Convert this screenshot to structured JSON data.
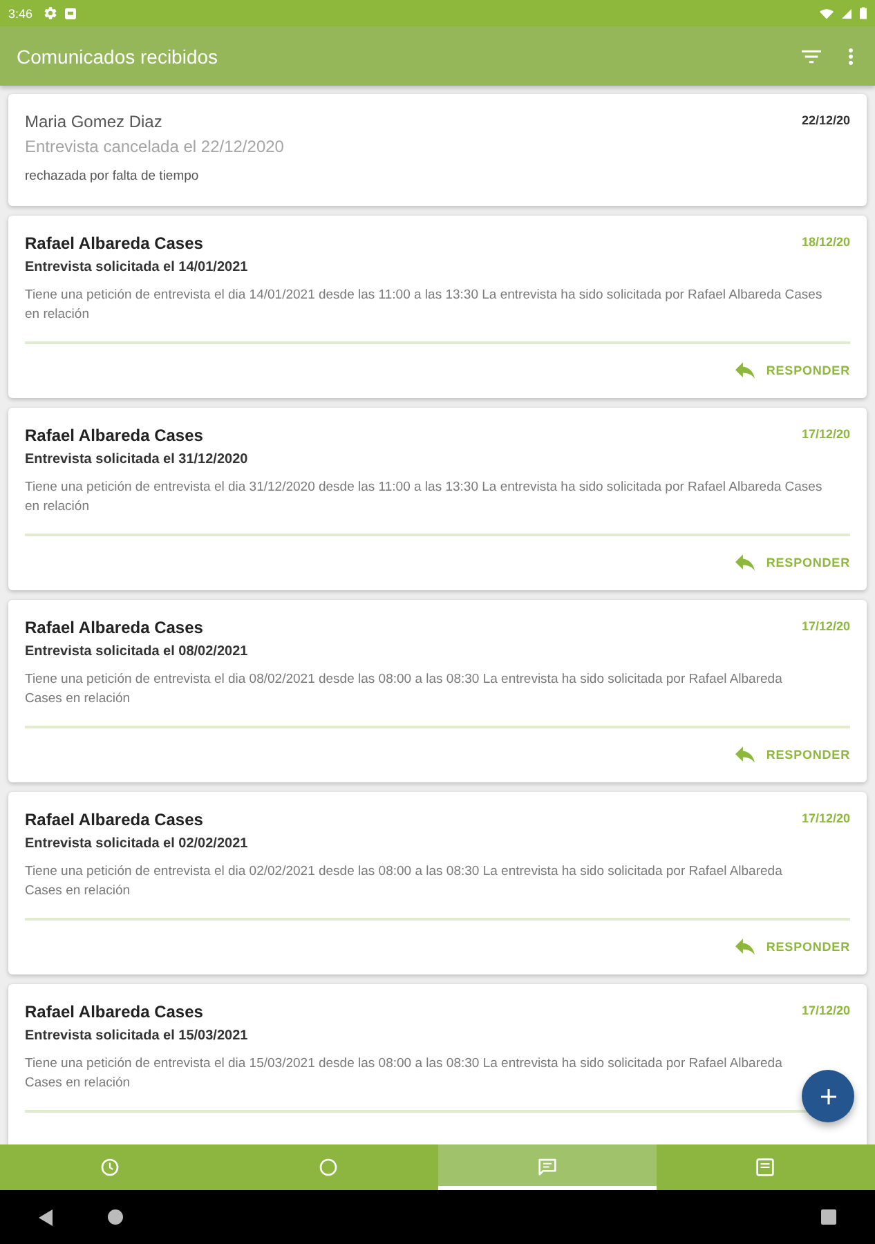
{
  "status_bar": {
    "time": "3:46"
  },
  "app_bar": {
    "title": "Comunicados recibidos"
  },
  "messages": [
    {
      "kind": "cancelled",
      "sender": "Maria Gomez Diaz",
      "date": "22/12/20",
      "subject": "Entrevista cancelada el 22/12/2020",
      "body": "rechazada por falta de tiempo"
    },
    {
      "kind": "request",
      "sender": "Rafael Albareda Cases",
      "date": "18/12/20",
      "subject": "Entrevista solicitada el 14/01/2021",
      "body": "Tiene una petición de entrevista el dia 14/01/2021 desde las 11:00 a las 13:30 La entrevista ha sido solicitada por Rafael Albareda Cases en relación",
      "action": "RESPONDER"
    },
    {
      "kind": "request",
      "sender": "Rafael Albareda Cases",
      "date": "17/12/20",
      "subject": "Entrevista solicitada el 31/12/2020",
      "body": "Tiene una petición de entrevista el dia 31/12/2020 desde las 11:00 a las 13:30 La entrevista ha sido solicitada por Rafael Albareda Cases en relación",
      "action": "RESPONDER"
    },
    {
      "kind": "request",
      "sender": "Rafael Albareda Cases",
      "date": "17/12/20",
      "subject": "Entrevista solicitada el 08/02/2021",
      "body": "Tiene una petición de entrevista el dia 08/02/2021 desde las 08:00 a las 08:30 La entrevista ha sido solicitada por Rafael Albareda Cases en relación",
      "action": "RESPONDER"
    },
    {
      "kind": "request",
      "sender": "Rafael Albareda Cases",
      "date": "17/12/20",
      "subject": "Entrevista solicitada el 02/02/2021",
      "body": "Tiene una petición de entrevista el dia 02/02/2021 desde las 08:00 a las 08:30 La entrevista ha sido solicitada por Rafael Albareda Cases en relación",
      "action": "RESPONDER"
    },
    {
      "kind": "request",
      "sender": "Rafael Albareda Cases",
      "date": "17/12/20",
      "subject": "Entrevista solicitada el 15/03/2021",
      "body": "Tiene una petición de entrevista el dia 15/03/2021 desde las 08:00 a las 08:30 La entrevista ha sido solicitada por Rafael Albareda Cases en relación"
    }
  ],
  "bottom_nav": [
    {
      "kind": "clock",
      "selected": false
    },
    {
      "kind": "circle",
      "selected": false
    },
    {
      "kind": "chat",
      "selected": true
    },
    {
      "kind": "document",
      "selected": false
    }
  ]
}
